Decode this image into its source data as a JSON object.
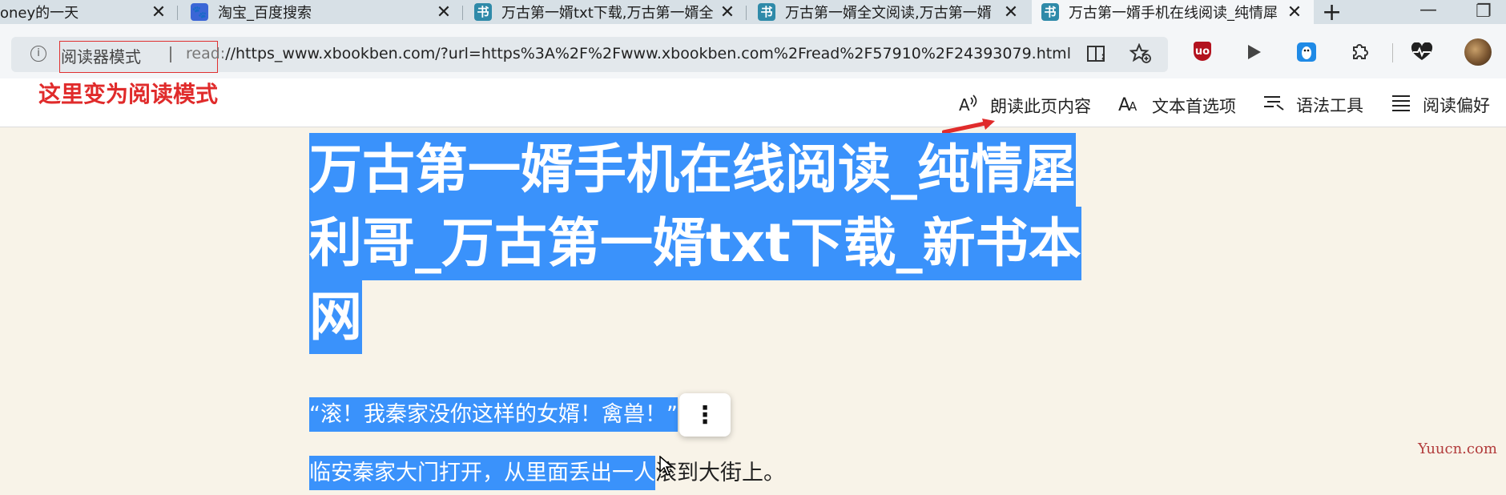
{
  "tabs": [
    {
      "title": "oney的一天",
      "icon": "none",
      "active": false
    },
    {
      "title": "淘宝_百度搜索",
      "icon": "baidu-paw-icon",
      "active": false
    },
    {
      "title": "万古第一婿txt下载,万古第一婿全",
      "icon": "book-site-icon",
      "active": false
    },
    {
      "title": "万古第一婿全文阅读,万古第一婿",
      "icon": "book-site-icon",
      "active": false
    },
    {
      "title": "万古第一婿手机在线阅读_纯情犀",
      "icon": "book-site-icon",
      "active": true
    }
  ],
  "favicon_glyph": "书",
  "tab_close_glyph": "✕",
  "new_tab_glyph": "+",
  "window": {
    "minimize": "—",
    "restore": "❐"
  },
  "address_bar": {
    "info_glyph": "i",
    "reader_mode_label": "阅读器模式",
    "url_scheme": "read:",
    "url_rest": "//https_www.xbookben.com/?url=https%3A%2F%2Fwww.xbookben.com%2Fread%2F57910%2F24393079.html"
  },
  "annotation": "这里变为阅读模式",
  "reader_toolbar": [
    {
      "label": "朗读此页内容",
      "icon": "read-aloud-icon",
      "glyph": "A)"
    },
    {
      "label": "文本首选项",
      "icon": "text-preferences-icon",
      "glyph": "AA"
    },
    {
      "label": "语法工具",
      "icon": "grammar-tools-icon",
      "glyph": "≡"
    },
    {
      "label": "阅读偏好",
      "icon": "reading-preferences-icon",
      "glyph": "☰"
    }
  ],
  "article": {
    "title_lines": [
      "万古第一婿手机在线阅读_纯情犀",
      "利哥_万古第一婿txt下载_新书本",
      "网"
    ],
    "para1": "“滚！我秦家没你这样的女婿！禽兽！”",
    "para2_selected": "临安秦家大门打开，从里面丢出一人",
    "para2_rest": "滚到大街上。"
  },
  "more_button_glyph": "⋮",
  "watermark": "Yuucn.com",
  "colors": {
    "selection": "#3a92fb",
    "annotation": "#e02b2b",
    "reader_bg": "#f8f3e8"
  }
}
